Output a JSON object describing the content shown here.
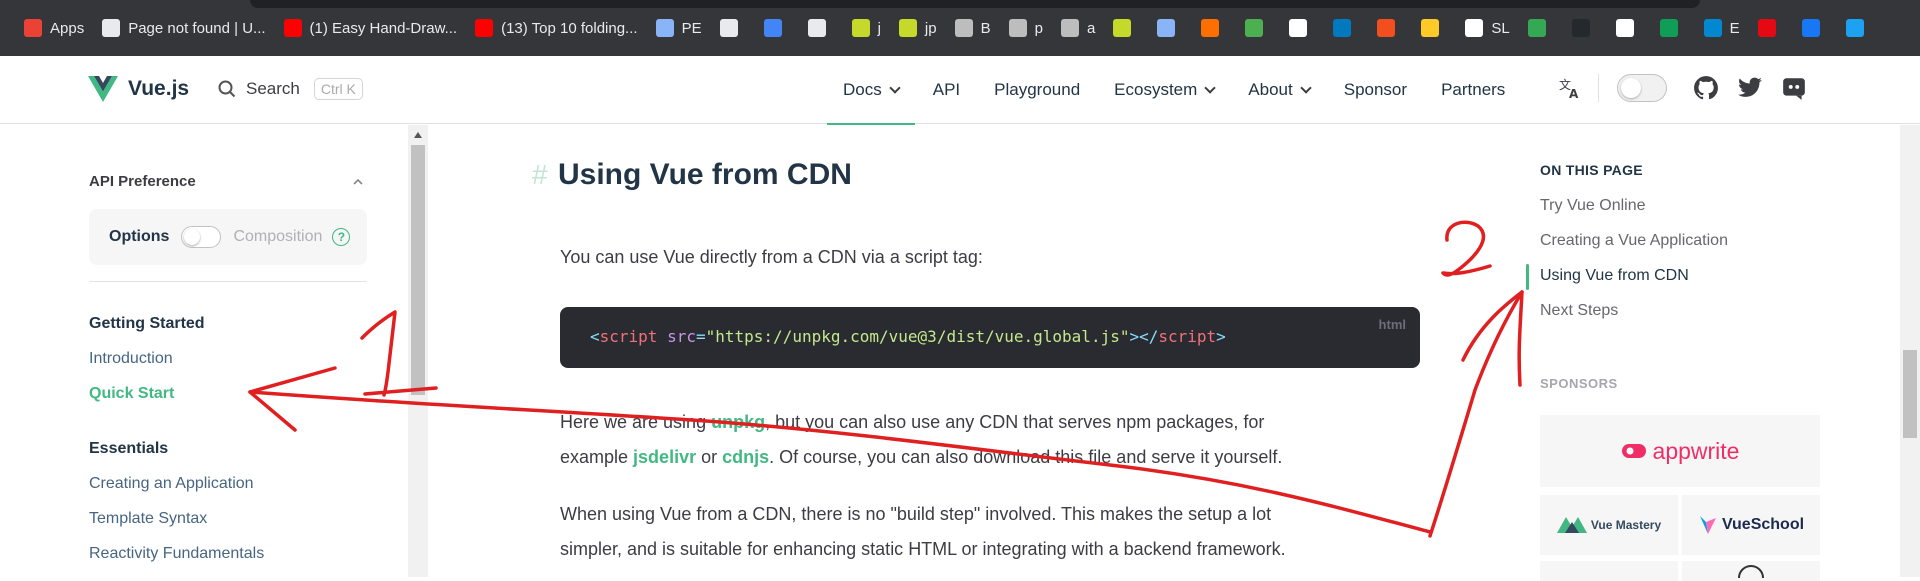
{
  "bookmarks": [
    {
      "label": "Apps",
      "color": "#ea4335"
    },
    {
      "label": "Page not found | U...",
      "color": "#e8eaed"
    },
    {
      "label": "(1) Easy Hand-Draw...",
      "color": "#ff0000"
    },
    {
      "label": "(13) Top 10 folding...",
      "color": "#ff0000"
    },
    {
      "label": "PE",
      "color": "#8ab4f8"
    },
    {
      "label": "",
      "color": "#e8eaed"
    },
    {
      "label": "",
      "color": "#4285f4"
    },
    {
      "label": "",
      "color": "#e8eaed"
    },
    {
      "label": "j",
      "color": "#c5d92b"
    },
    {
      "label": "jp",
      "color": "#c5d92b"
    },
    {
      "label": "B",
      "color": "#bdbdbd"
    },
    {
      "label": "p",
      "color": "#bdbdbd"
    },
    {
      "label": "a",
      "color": "#bdbdbd"
    },
    {
      "label": "",
      "color": "#c5d92b"
    },
    {
      "label": "",
      "color": "#8ab4f8"
    },
    {
      "label": "",
      "color": "#ff6f00"
    },
    {
      "label": "",
      "color": "#4caf50"
    },
    {
      "label": "",
      "color": "#ffffff"
    },
    {
      "label": "",
      "color": "#0079bf"
    },
    {
      "label": "",
      "color": "#f24e1e"
    },
    {
      "label": "",
      "color": "#ffca28"
    },
    {
      "label": "SL",
      "color": "#ffffff"
    },
    {
      "label": "",
      "color": "#34a853"
    },
    {
      "label": "",
      "color": "#24292e"
    },
    {
      "label": "",
      "color": "#ffffff"
    },
    {
      "label": "",
      "color": "#0f9d58"
    },
    {
      "label": "E",
      "color": "#0288d1"
    },
    {
      "label": "",
      "color": "#e50914"
    },
    {
      "label": "",
      "color": "#1877f2"
    },
    {
      "label": "",
      "color": "#1da1f2"
    }
  ],
  "nav": {
    "logo": "Vue.js",
    "search_label": "Search",
    "search_kbd": "Ctrl K",
    "items": [
      {
        "label": "Docs",
        "dropdown": true,
        "active": true
      },
      {
        "label": "API",
        "dropdown": false
      },
      {
        "label": "Playground",
        "dropdown": false
      },
      {
        "label": "Ecosystem",
        "dropdown": true
      },
      {
        "label": "About",
        "dropdown": true
      },
      {
        "label": "Sponsor",
        "dropdown": false
      },
      {
        "label": "Partners",
        "dropdown": false
      }
    ]
  },
  "sidebar": {
    "pref_title": "API Preference",
    "options_label": "Options",
    "composition_label": "Composition",
    "help": "?",
    "groups": [
      {
        "title": "Getting Started",
        "items": [
          {
            "label": "Introduction"
          },
          {
            "label": "Quick Start",
            "active": true
          }
        ]
      },
      {
        "title": "Essentials",
        "items": [
          {
            "label": "Creating an Application"
          },
          {
            "label": "Template Syntax"
          },
          {
            "label": "Reactivity Fundamentals"
          }
        ]
      }
    ]
  },
  "content": {
    "heading": "Using Vue from CDN",
    "hash": "#",
    "intro": "You can use Vue directly from a CDN via a script tag:",
    "code": {
      "open": "<",
      "tag": "script",
      "attr": "src",
      "eq": "=",
      "url": "\"https://unpkg.com/vue@3/dist/vue.global.js\"",
      "close_open": "></",
      "close_gt": ">",
      "lang": "html"
    },
    "p2_a": "Here we are using ",
    "p2_link1": "unpkg",
    "p2_b": ", but you can also use any CDN that serves npm packages, for",
    "p2_c": "example ",
    "p2_link2": "jsdelivr",
    "p2_d": " or ",
    "p2_link3": "cdnjs",
    "p2_e": ". Of course, you can also download this file and serve it yourself.",
    "p3_line1": "When using Vue from a CDN, there is no \"build step\" involved. This makes the setup a lot",
    "p3_line2": "simpler, and is suitable for enhancing static HTML or integrating with a backend framework."
  },
  "aside": {
    "title": "ON THIS PAGE",
    "items": [
      {
        "label": "Try Vue Online"
      },
      {
        "label": "Creating a Vue Application"
      },
      {
        "label": "Using Vue from CDN",
        "active": true
      },
      {
        "label": "Next Steps"
      }
    ],
    "sponsors_title": "SPONSORS",
    "sponsors": [
      {
        "label": "appwrite"
      },
      {
        "label": "Vue Mastery"
      },
      {
        "label": "VueSchool"
      }
    ]
  },
  "annotations": {
    "one": "1",
    "two": "2",
    "color": "#e02020"
  },
  "colors": {
    "accent": "#42b883",
    "text": "#213547",
    "code_bg": "#292b30"
  }
}
